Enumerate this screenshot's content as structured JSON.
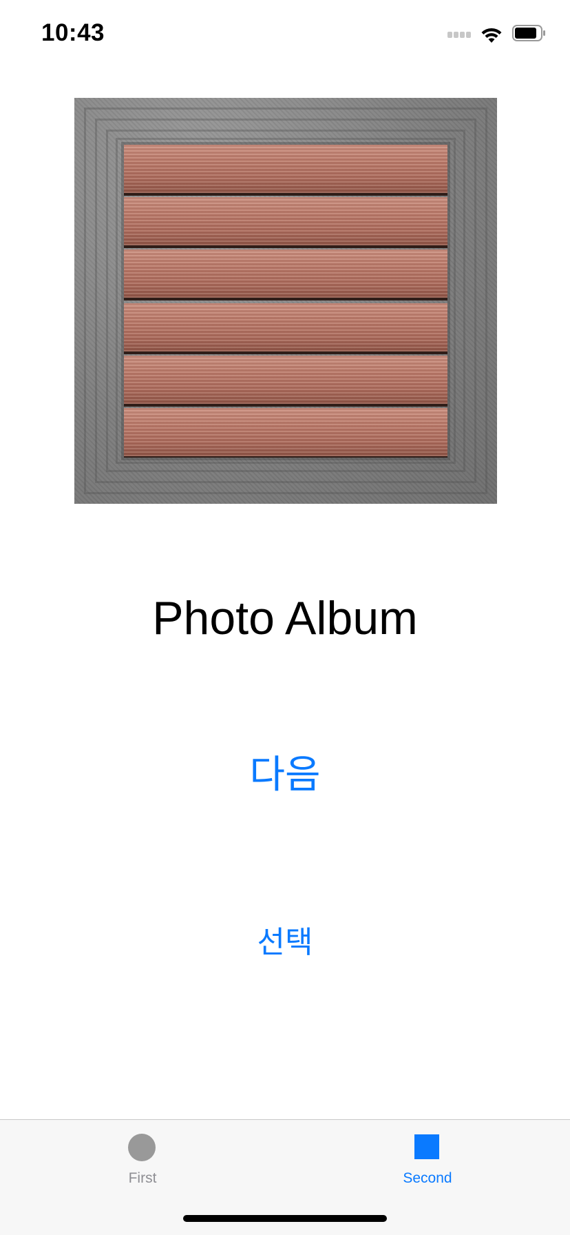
{
  "status_bar": {
    "time": "10:43"
  },
  "main": {
    "title": "Photo Album",
    "next_button": "다음",
    "select_button": "선택"
  },
  "tab_bar": {
    "tabs": [
      {
        "label": "First",
        "icon": "circle-icon",
        "selected": false
      },
      {
        "label": "Second",
        "icon": "square-icon",
        "selected": true
      }
    ]
  },
  "colors": {
    "accent": "#0a7aff",
    "inactive": "#999999",
    "tab_bar_background": "#f7f7f7"
  }
}
